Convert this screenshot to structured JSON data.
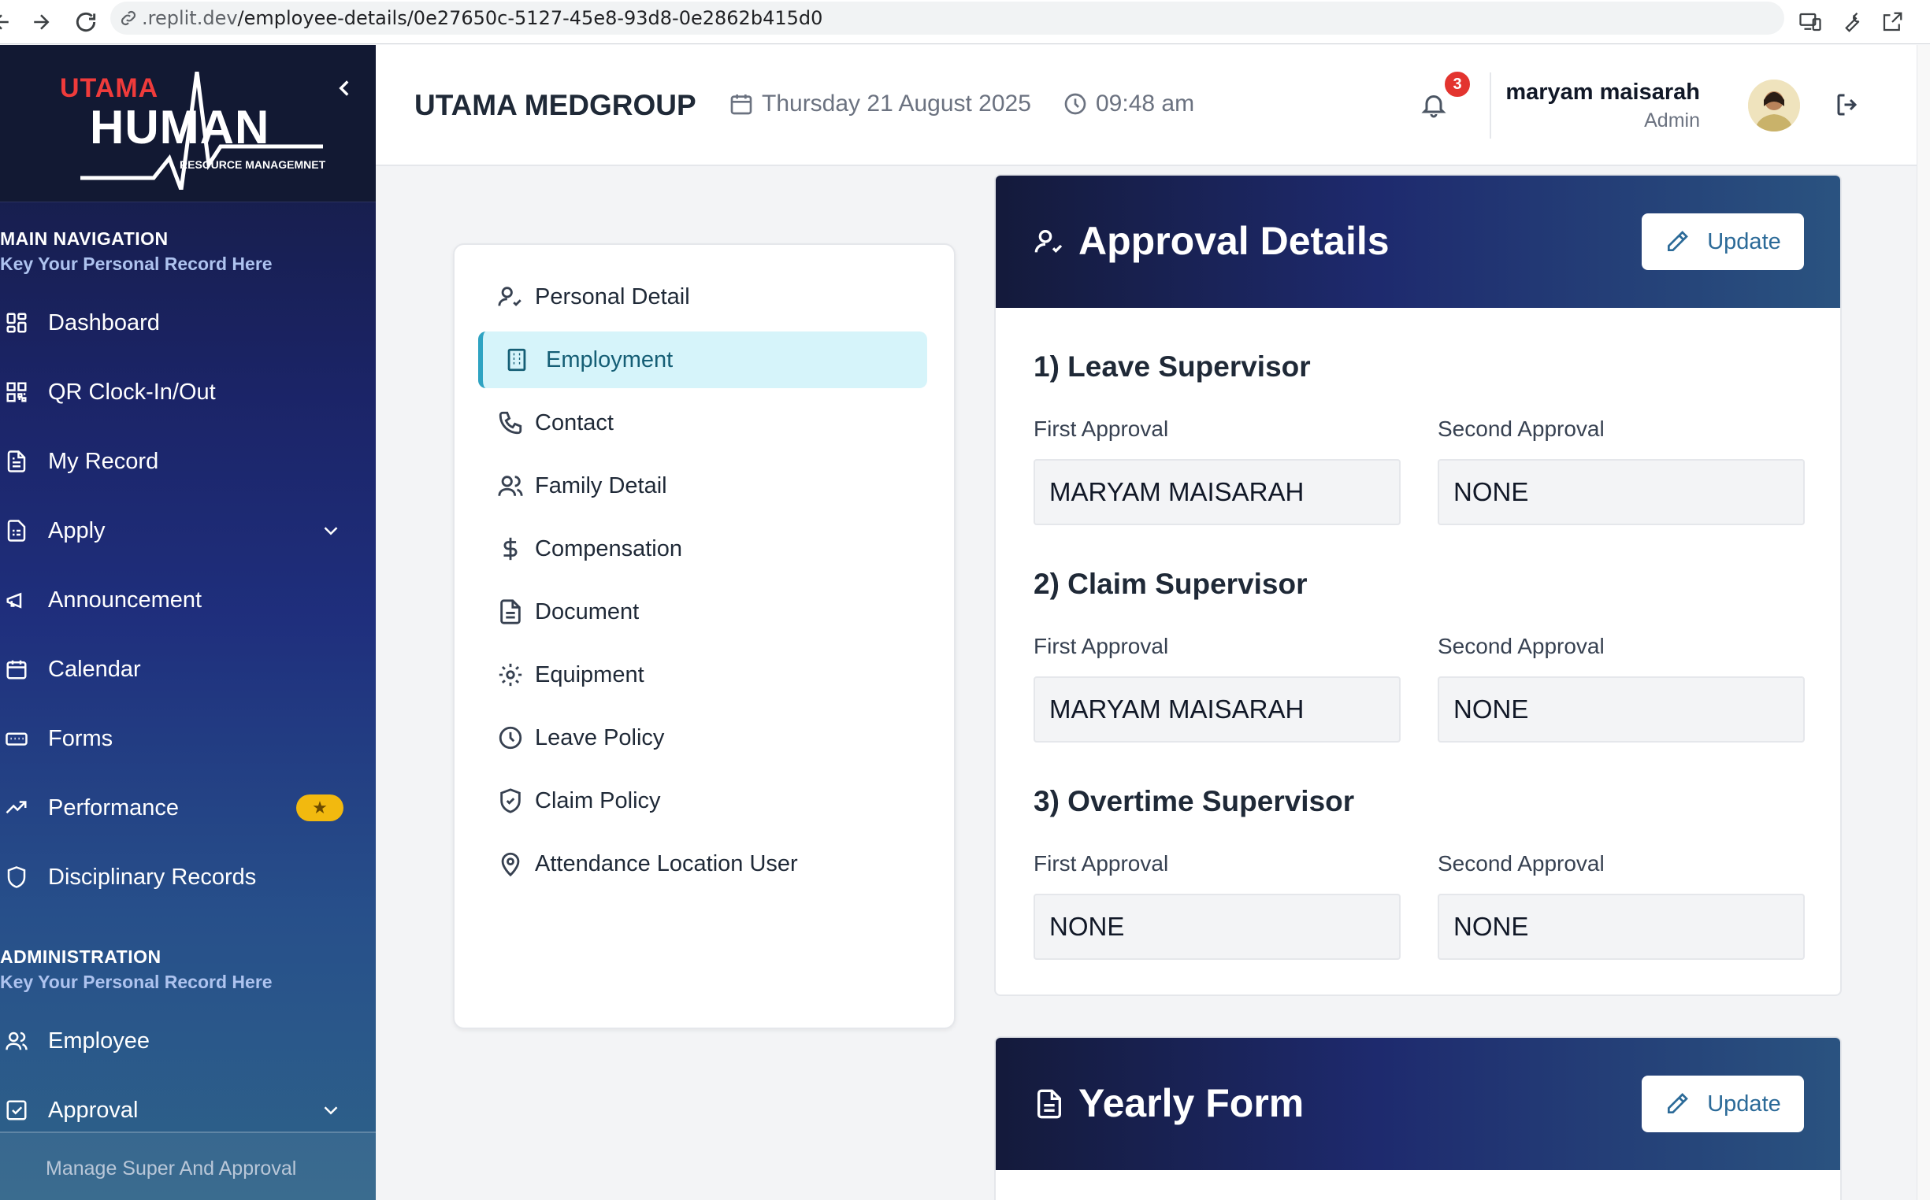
{
  "browser": {
    "url_host": ".replit.dev",
    "url_path": "/employee-details/0e27650c-5127-45e8-93d8-0e2862b415d0"
  },
  "sidebar": {
    "logo": {
      "top": "UTAMA",
      "main": "HUMAN",
      "sub": "RESOURCE MANAGEMNET"
    },
    "main_nav": {
      "title": "MAIN NAVIGATION",
      "subtitle": "Key Your Personal Record Here",
      "items": [
        {
          "label": "Dashboard",
          "icon": "dashboard-icon"
        },
        {
          "label": "QR Clock-In/Out",
          "icon": "qr-code-icon"
        },
        {
          "label": "My Record",
          "icon": "file-text-icon"
        },
        {
          "label": "Apply",
          "icon": "clipboard-icon"
        },
        {
          "label": "Announcement",
          "icon": "megaphone-icon"
        },
        {
          "label": "Calendar",
          "icon": "calendar-icon"
        },
        {
          "label": "Forms",
          "icon": "form-icon"
        },
        {
          "label": "Performance",
          "icon": "trending-up-icon",
          "badge": "★"
        },
        {
          "label": "Disciplinary Records",
          "icon": "shield-icon"
        }
      ]
    },
    "admin": {
      "title": "ADMINISTRATION",
      "subtitle": "Key Your Personal Record Here",
      "items": [
        {
          "label": "Employee",
          "icon": "users-icon"
        },
        {
          "label": "Approval",
          "icon": "check-square-icon"
        }
      ],
      "sub_item": "Manage Super And Approval"
    }
  },
  "header": {
    "company": "UTAMA MEDGROUP",
    "date": "Thursday 21 August 2025",
    "time": "09:48 am",
    "notification_count": "3",
    "user_name": "maryam maisarah",
    "user_role": "Admin"
  },
  "menu": {
    "active_index": 1,
    "items": [
      {
        "label": "Personal Detail",
        "icon": "user-check-icon"
      },
      {
        "label": "Employment",
        "icon": "building-icon"
      },
      {
        "label": "Contact",
        "icon": "phone-icon"
      },
      {
        "label": "Family Detail",
        "icon": "users-icon"
      },
      {
        "label": "Compensation",
        "icon": "dollar-icon"
      },
      {
        "label": "Document",
        "icon": "document-icon"
      },
      {
        "label": "Equipment",
        "icon": "gear-icon"
      },
      {
        "label": "Leave Policy",
        "icon": "clock-icon"
      },
      {
        "label": "Claim Policy",
        "icon": "shield-check-icon"
      },
      {
        "label": "Attendance Location User",
        "icon": "map-pin-icon"
      }
    ]
  },
  "approval": {
    "title": "Approval Details",
    "update_label": "Update",
    "first_label": "First Approval",
    "second_label": "Second Approval",
    "sections": [
      {
        "title": "1) Leave Supervisor",
        "first": "MARYAM MAISARAH",
        "second": "NONE"
      },
      {
        "title": "2) Claim Supervisor",
        "first": "MARYAM MAISARAH",
        "second": "NONE"
      },
      {
        "title": "3) Overtime Supervisor",
        "first": "NONE",
        "second": "NONE"
      }
    ]
  },
  "yearly": {
    "title": "Yearly Form",
    "update_label": "Update"
  },
  "colors": {
    "sidebar_dark": "#141a3b",
    "accent_active": "#2ea3c2",
    "badge_red": "#e3342f",
    "star_badge": "#f2b90f",
    "button_text": "#2b6a98"
  }
}
